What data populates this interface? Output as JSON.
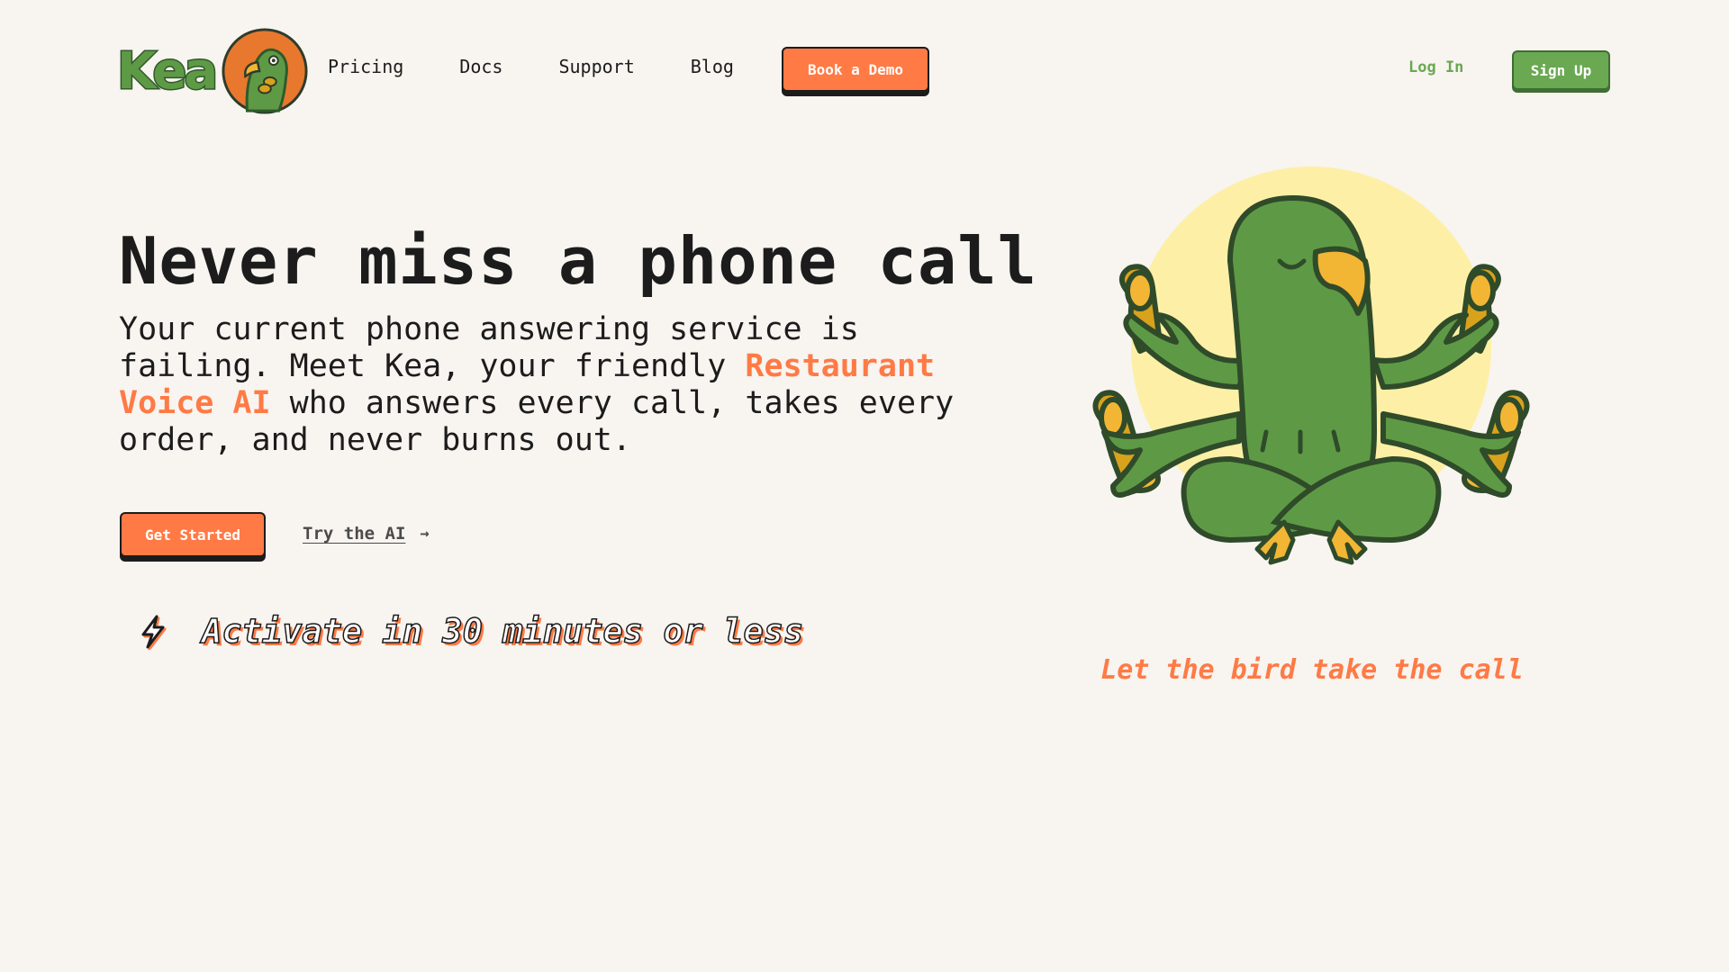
{
  "brand": {
    "name": "Kea",
    "colors": {
      "accent": "#ff7a45",
      "green": "#6aa852",
      "background": "#f8f4f0",
      "text": "#1c1c1c"
    }
  },
  "nav": {
    "links": [
      "Pricing",
      "Docs",
      "Support",
      "Blog"
    ],
    "demo_label": "Book a Demo",
    "login_label": "Log In",
    "signup_label": "Sign Up"
  },
  "hero": {
    "title": "Never miss a phone call",
    "subtitle_pre": "Your current phone answering service is failing. Meet Kea, your friendly ",
    "subtitle_highlight": "Restaurant Voice AI",
    "subtitle_post": " who answers every call, takes every order, and never burns out.",
    "cta_primary": "Get Started",
    "cta_secondary": "Try the AI",
    "cta_secondary_icon": "arrow-right-icon",
    "activate_icon": "lightning-bolt-icon",
    "activate_text": "Activate in 30 minutes or less"
  },
  "illustration": {
    "subject": "parrot-mascot-icon",
    "tagline": "Let the bird take the call"
  }
}
